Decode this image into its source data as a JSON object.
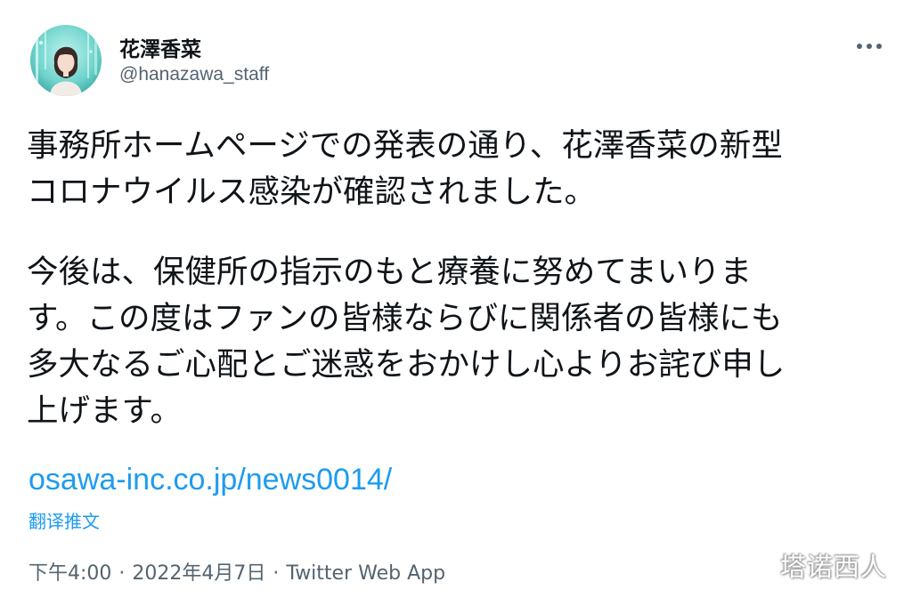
{
  "author": {
    "display_name": "花澤香菜",
    "handle": "@hanazawa_staff"
  },
  "tweet": {
    "lines_paragraph_1": [
      "事務所ホームページでの発表の通り、花澤香菜の新型",
      "コロナウイルス感染が確認されました。"
    ],
    "lines_paragraph_2": [
      "今後は、保健所の指示のもと療養に努めてまいりま",
      "す。この度はファンの皆様ならびに関係者の皆様にも",
      "多大なるご心配とご迷惑をおかけし心よりお詫び申し",
      "上げます。"
    ],
    "link_text": "osawa-inc.co.jp/news0014/",
    "translate_label": "翻译推文"
  },
  "meta": {
    "time": "下午4:00",
    "separator": "·",
    "date": "2022年4月7日",
    "source": "Twitter Web App"
  },
  "watermark": {
    "text": "塔诺西人"
  },
  "icons": {
    "more": "more-horizontal-icon",
    "avatar": "profile-photo"
  },
  "colors": {
    "text": "#0f1419",
    "secondary": "#536471",
    "link": "#1d9bf0",
    "background": "#ffffff"
  }
}
